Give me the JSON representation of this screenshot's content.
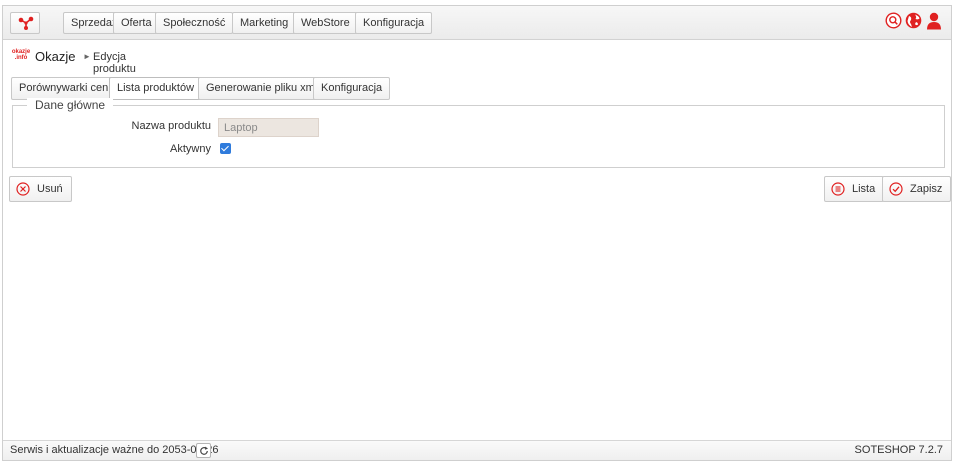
{
  "topbar": {
    "logo_icon": "soteshop-logo-icon",
    "menu": [
      "Sprzedaż",
      "Oferta",
      "Społeczność",
      "Marketing",
      "WebStore",
      "Konfiguracja"
    ],
    "icons": [
      "search-icon",
      "globe-icon",
      "user-icon"
    ],
    "accent_color": "#e02121"
  },
  "breadcrumb": {
    "logo_text": [
      "okazje",
      ".info"
    ],
    "title": "Okazje",
    "separator": "►",
    "current": "Edycja produktu"
  },
  "tabs": [
    "Porównywarki cen",
    "Lista produktów",
    "Generowanie pliku xml",
    "Konfiguracja"
  ],
  "active_tab": "Lista produktów",
  "form": {
    "legend": "Dane główne",
    "name_label": "Nazwa produktu",
    "name_value": "Laptop",
    "active_label": "Aktywny",
    "active_checked": true
  },
  "actions": {
    "delete_label": "Usuń",
    "list_label": "Lista",
    "save_label": "Zapisz"
  },
  "footer": {
    "service_text": "Serwis i aktualizacje ważne do 2053-08-26",
    "version": "SOTESHOP 7.2.7"
  }
}
